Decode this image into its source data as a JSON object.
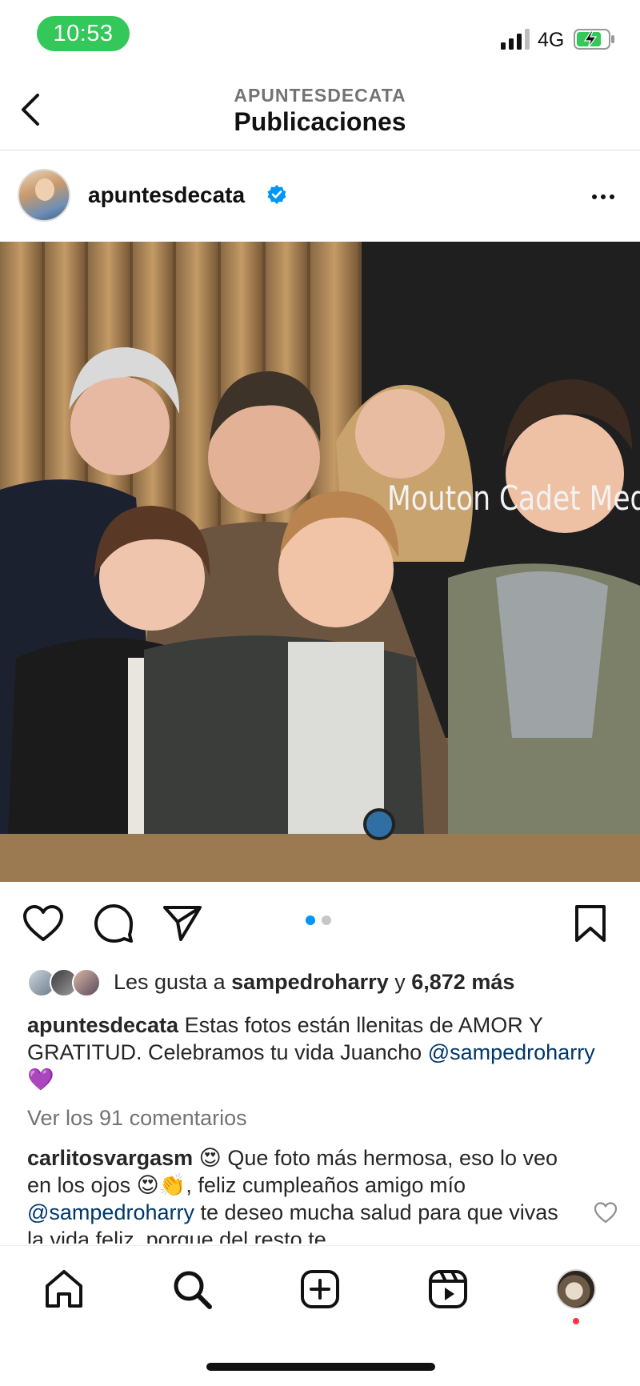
{
  "status_bar": {
    "time": "10:53",
    "network": "4G",
    "time_pill_color": "#34c759",
    "battery_color": "#34c759"
  },
  "header": {
    "account": "APUNTESDECATA",
    "title": "Publicaciones"
  },
  "post": {
    "username": "apuntesdecata",
    "verified": true,
    "photo_sign_text": "Mouton Cadet Med",
    "carousel": {
      "count": 2,
      "active_index": 0,
      "active_color": "#0095f6"
    },
    "likes": {
      "prefix": "Les gusta a",
      "user": "sampedroharry",
      "joiner": "y",
      "others": "6,872 más"
    },
    "caption": {
      "username": "apuntesdecata",
      "text": "Estas fotos están llenitas de AMOR Y GRATITUD.  Celebramos tu vida Juancho",
      "mention": "@sampedroharry",
      "emoji": "💜"
    },
    "view_comments": "Ver los 91 comentarios",
    "comment": {
      "username": "carlitosvargasm",
      "emoji1": "😍",
      "text1": "Que foto más hermosa, eso lo veo en los ojos",
      "emoji2": "😍👏",
      "text2": ", feliz cumpleaños amigo mío",
      "mention": "@sampedroharry",
      "text3": "te deseo mucha salud para que vivas la vida feliz, porque del resto te"
    }
  },
  "nav": {
    "items": [
      "home-icon",
      "search-icon",
      "new-post-icon",
      "reels-icon",
      "profile-avatar"
    ],
    "notification_color": "#ff3040"
  },
  "colors": {
    "mention": "#00376b",
    "secondary_text": "#737373",
    "verified_badge": "#0095f6"
  }
}
